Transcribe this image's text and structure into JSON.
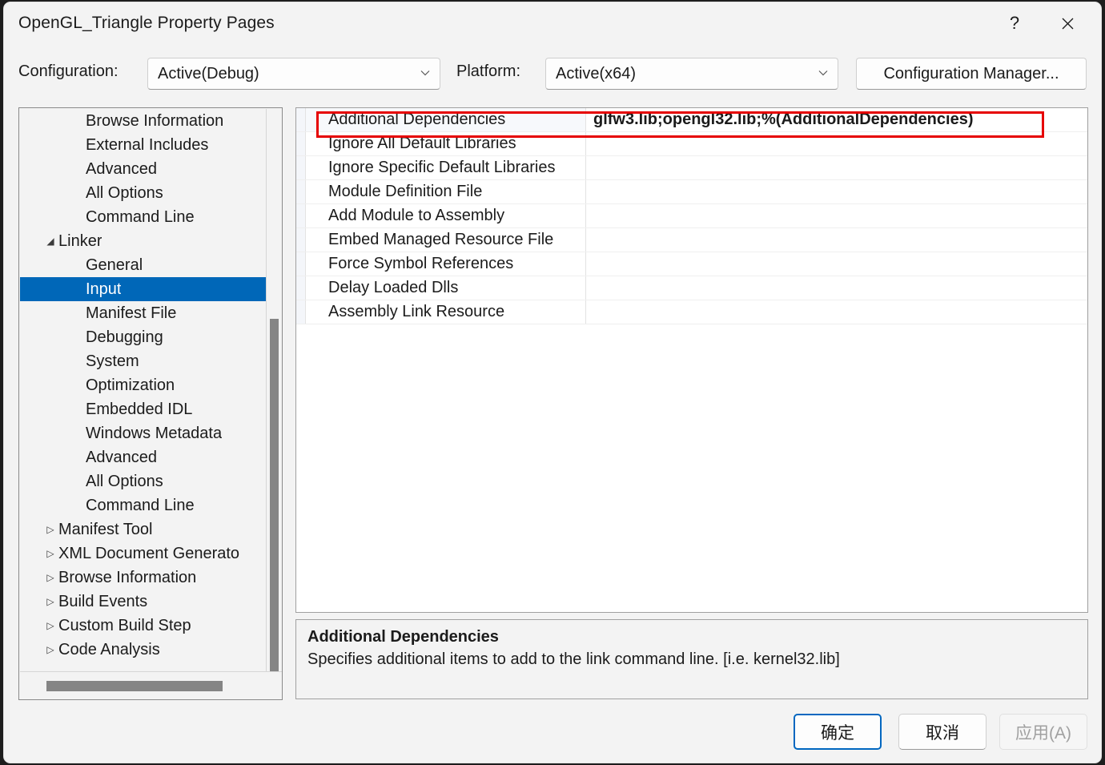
{
  "window": {
    "title": "OpenGL_Triangle Property Pages",
    "help_icon": "question-mark-icon",
    "close_icon": "close-icon"
  },
  "config_bar": {
    "configuration_label": "Configuration:",
    "configuration_value": "Active(Debug)",
    "platform_label": "Platform:",
    "platform_value": "Active(x64)",
    "configuration_manager_label": "Configuration Manager..."
  },
  "tree": {
    "selected": "Input",
    "expanded_glyph": "◢",
    "collapsed_glyph": "▷",
    "items": [
      {
        "label": "Browse Information",
        "level": 2,
        "arrow": "",
        "selected": false
      },
      {
        "label": "External Includes",
        "level": 2,
        "arrow": "",
        "selected": false
      },
      {
        "label": "Advanced",
        "level": 2,
        "arrow": "",
        "selected": false
      },
      {
        "label": "All Options",
        "level": 2,
        "arrow": "",
        "selected": false
      },
      {
        "label": "Command Line",
        "level": 2,
        "arrow": "",
        "selected": false
      },
      {
        "label": "Linker",
        "level": 1,
        "arrow": "◢",
        "selected": false
      },
      {
        "label": "General",
        "level": 2,
        "arrow": "",
        "selected": false
      },
      {
        "label": "Input",
        "level": 2,
        "arrow": "",
        "selected": true
      },
      {
        "label": "Manifest File",
        "level": 2,
        "arrow": "",
        "selected": false
      },
      {
        "label": "Debugging",
        "level": 2,
        "arrow": "",
        "selected": false
      },
      {
        "label": "System",
        "level": 2,
        "arrow": "",
        "selected": false
      },
      {
        "label": "Optimization",
        "level": 2,
        "arrow": "",
        "selected": false
      },
      {
        "label": "Embedded IDL",
        "level": 2,
        "arrow": "",
        "selected": false
      },
      {
        "label": "Windows Metadata",
        "level": 2,
        "arrow": "",
        "selected": false
      },
      {
        "label": "Advanced",
        "level": 2,
        "arrow": "",
        "selected": false
      },
      {
        "label": "All Options",
        "level": 2,
        "arrow": "",
        "selected": false
      },
      {
        "label": "Command Line",
        "level": 2,
        "arrow": "",
        "selected": false
      },
      {
        "label": "Manifest Tool",
        "level": 1,
        "arrow": "▷",
        "selected": false
      },
      {
        "label": "XML Document Generato",
        "level": 1,
        "arrow": "▷",
        "selected": false
      },
      {
        "label": "Browse Information",
        "level": 1,
        "arrow": "▷",
        "selected": false
      },
      {
        "label": "Build Events",
        "level": 1,
        "arrow": "▷",
        "selected": false
      },
      {
        "label": "Custom Build Step",
        "level": 1,
        "arrow": "▷",
        "selected": false
      },
      {
        "label": "Code Analysis",
        "level": 1,
        "arrow": "▷",
        "selected": false
      }
    ]
  },
  "grid": {
    "highlight_color": "#e60000",
    "rows": [
      {
        "name": "Additional Dependencies",
        "value": "glfw3.lib;opengl32.lib;%(AdditionalDependencies)",
        "highlighted": true
      },
      {
        "name": "Ignore All Default Libraries",
        "value": "",
        "highlighted": false
      },
      {
        "name": "Ignore Specific Default Libraries",
        "value": "",
        "highlighted": false
      },
      {
        "name": "Module Definition File",
        "value": "",
        "highlighted": false
      },
      {
        "name": "Add Module to Assembly",
        "value": "",
        "highlighted": false
      },
      {
        "name": "Embed Managed Resource File",
        "value": "",
        "highlighted": false
      },
      {
        "name": "Force Symbol References",
        "value": "",
        "highlighted": false
      },
      {
        "name": "Delay Loaded Dlls",
        "value": "",
        "highlighted": false
      },
      {
        "name": "Assembly Link Resource",
        "value": "",
        "highlighted": false
      }
    ]
  },
  "description": {
    "title": "Additional Dependencies",
    "body": "Specifies additional items to add to the link command line. [i.e. kernel32.lib]"
  },
  "footer": {
    "ok_label": "确定",
    "cancel_label": "取消",
    "apply_label": "应用(A)"
  }
}
